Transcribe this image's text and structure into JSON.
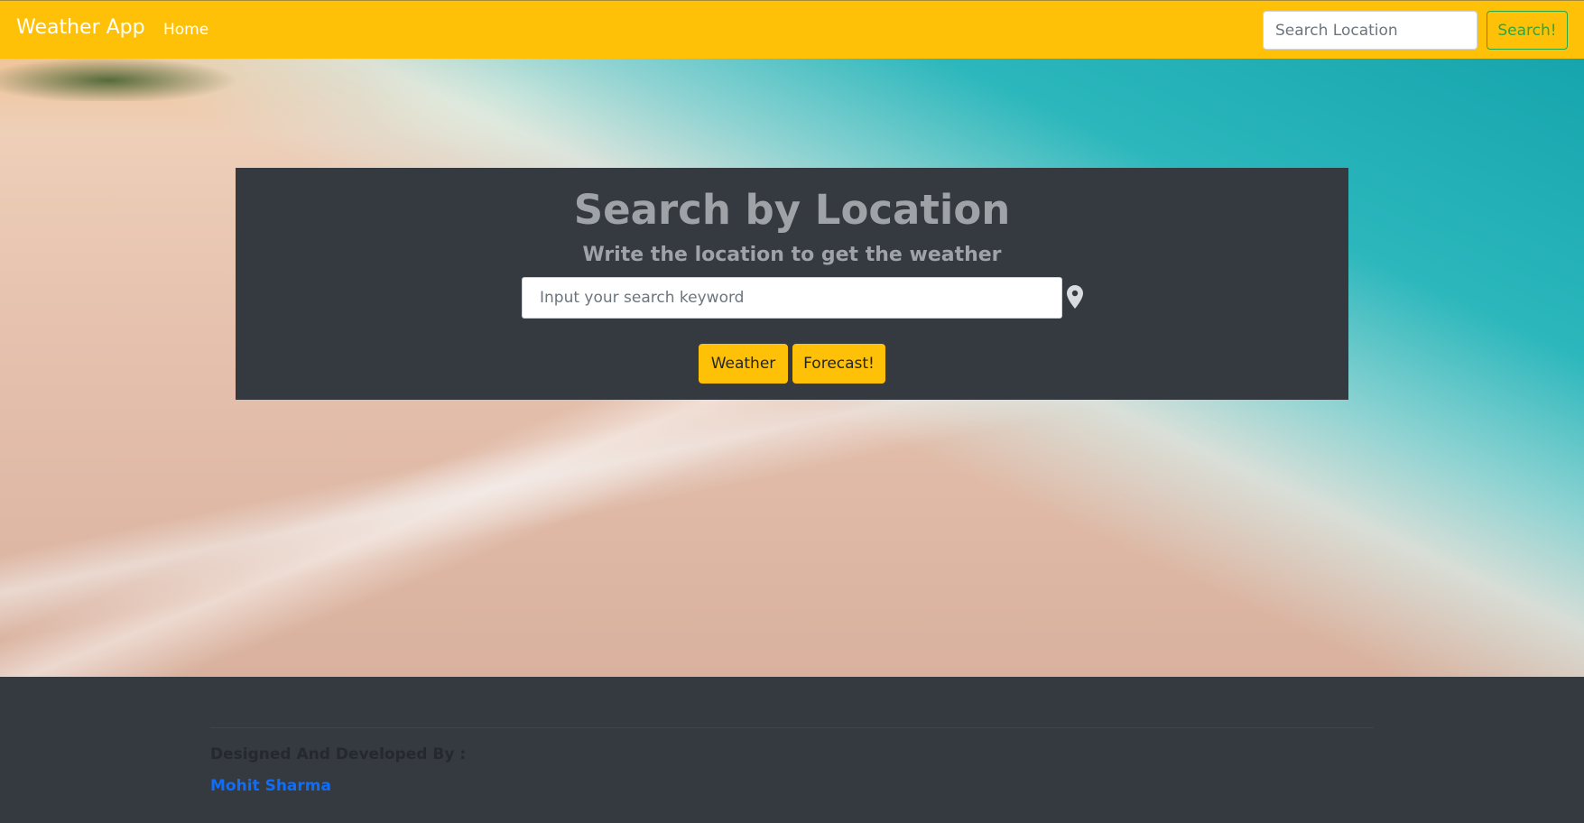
{
  "navbar": {
    "brand": "Weather App",
    "home_link": "Home",
    "search_placeholder": "Search Location",
    "search_button": "Search!"
  },
  "hero": {
    "background": "beach-sunset-photo"
  },
  "search_card": {
    "title": "Search by Location",
    "subtitle": "Write the location to get the weather",
    "input_placeholder": "Input your search keyword",
    "location_icon": "map-pin-icon",
    "weather_button": "Weather",
    "forecast_button": "Forecast!"
  },
  "footer": {
    "credit": "Designed And Developed By :",
    "author": "Mohit Sharma"
  },
  "colors": {
    "navbar": "#ffc107",
    "card": "#343a40",
    "success": "#28a745",
    "link": "#0d6efd"
  }
}
